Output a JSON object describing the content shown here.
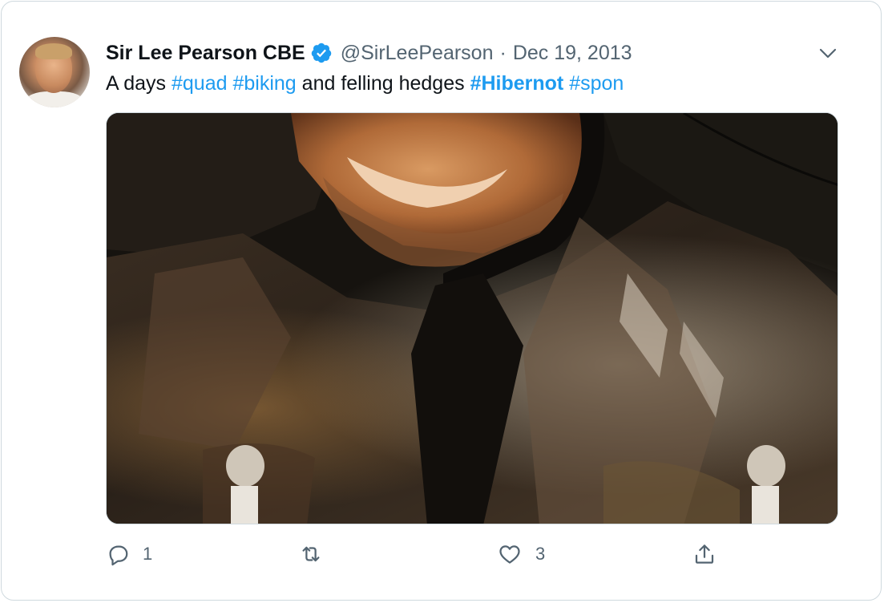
{
  "tweet": {
    "author_name": "Sir Lee Pearson CBE",
    "handle": "@SirLeePearson",
    "separator": "·",
    "date": "Dec 19, 2013",
    "text_parts": {
      "p1": "A days ",
      "t1": "#quad",
      "p2": " ",
      "t2": "#biking",
      "p3": " and felling hedges ",
      "t3": "#Hibernot",
      "p4": " ",
      "t4": "#spon"
    }
  },
  "actions": {
    "reply_count": "1",
    "like_count": "3"
  },
  "icons": {
    "verified": "verified-badge-icon",
    "more": "chevron-down-icon",
    "reply": "reply-icon",
    "retweet": "retweet-icon",
    "like": "heart-icon",
    "share": "share-icon"
  },
  "colors": {
    "link": "#1d9bf0",
    "text": "#0f1419",
    "secondary": "#536471",
    "border": "#cfd9de"
  }
}
